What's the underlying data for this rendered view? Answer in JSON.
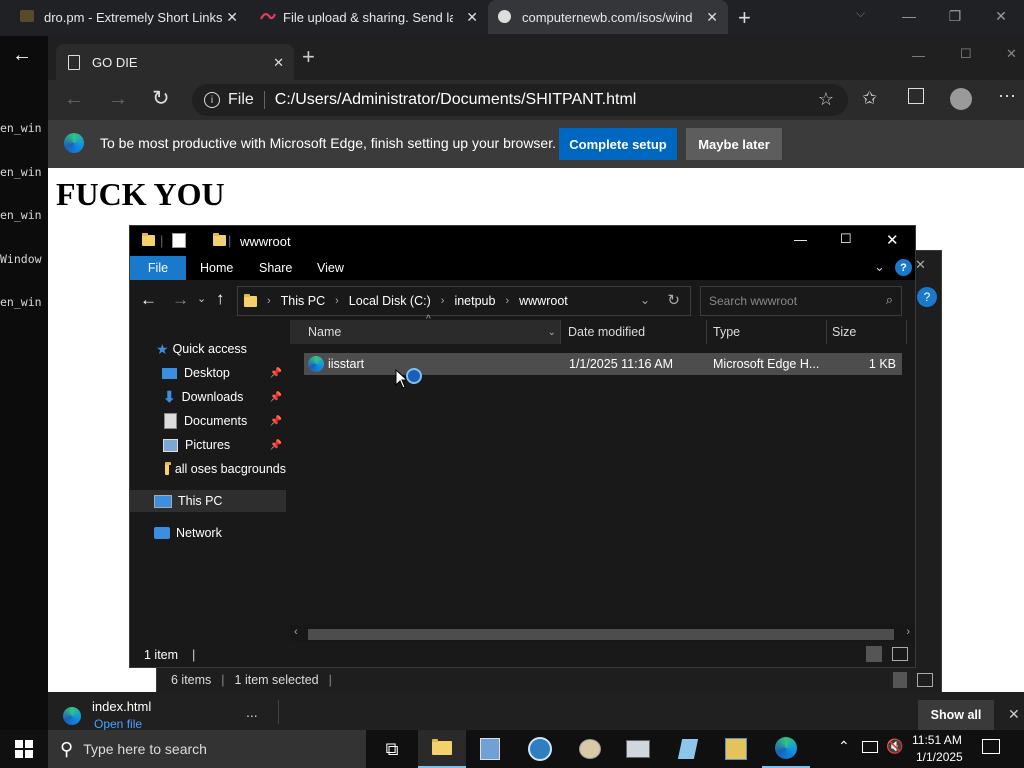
{
  "outer_browser": {
    "tabs": [
      {
        "title": "dro.pm - Extremely Short Links"
      },
      {
        "title": "File upload & sharing. Send larg"
      },
      {
        "title": "computernewb.com/isos/windo"
      }
    ],
    "new_tab_glyph": "+"
  },
  "console": {
    "lines": [
      "en_win",
      "en_win",
      "en_win",
      "Window",
      "en_win"
    ]
  },
  "edge": {
    "tab_title": "GO DIE",
    "address_label": "File",
    "address_url": "C:/Users/Administrator/Documents/SHITPANT.html",
    "infobar_text": "To be most productive with Microsoft Edge, finish setting up your browser.",
    "complete_setup": "Complete setup",
    "maybe_later": "Maybe later",
    "page_heading": "FUCK YOU"
  },
  "explorer": {
    "title": "wwwroot",
    "ribbon_tabs": [
      "File",
      "Home",
      "Share",
      "View"
    ],
    "breadcrumb": [
      "This PC",
      "Local Disk (C:)",
      "inetpub",
      "wwwroot"
    ],
    "search_placeholder": "Search wwwroot",
    "columns": [
      "Name",
      "Date modified",
      "Type",
      "Size"
    ],
    "sidebar": {
      "quick_access": "Quick access",
      "items": [
        "Desktop",
        "Downloads",
        "Documents",
        "Pictures",
        "all oses bacgrounds"
      ],
      "this_pc": "This PC",
      "network": "Network"
    },
    "files": [
      {
        "name": "iisstart",
        "date": "1/1/2025 11:16 AM",
        "type": "Microsoft Edge H...",
        "size": "1 KB"
      }
    ],
    "status": "1 item"
  },
  "explorer_back": {
    "status_items": "6 items",
    "status_selected": "1 item selected"
  },
  "downloads_bar": {
    "filename": "index.html",
    "action": "Open file",
    "more": "...",
    "show_all": "Show all"
  },
  "taskbar": {
    "search_placeholder": "Type here to search",
    "time": "11:51 AM",
    "date": "1/1/2025"
  },
  "colors": {
    "edge_accent": "#0067c0",
    "explorer_ribbon_file": "#1979ca",
    "taskbar_bg": "#101010"
  }
}
